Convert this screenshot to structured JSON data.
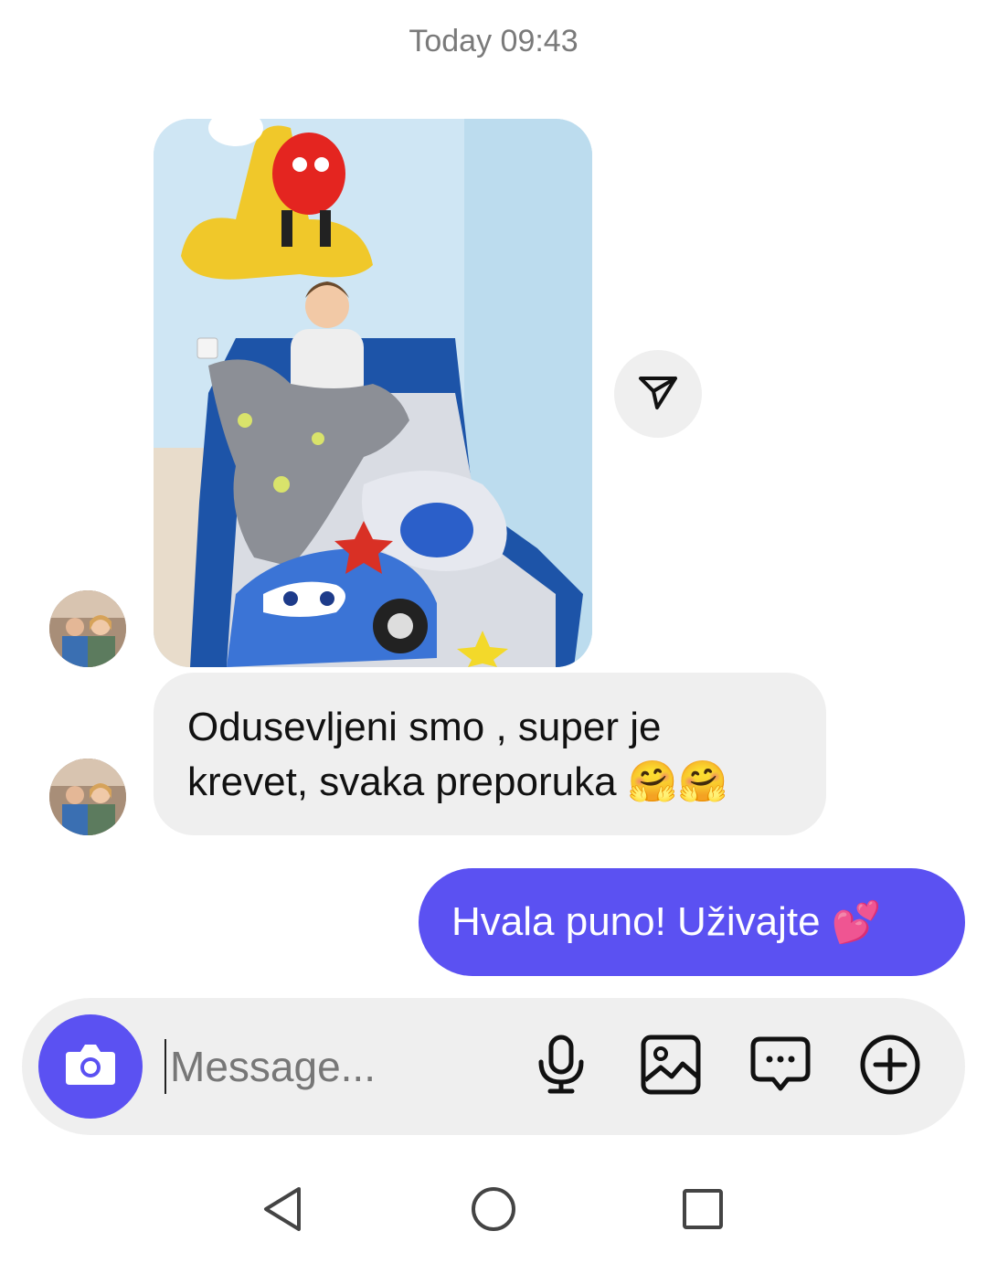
{
  "header": {
    "timestamp": "Today 09:43"
  },
  "conversation": {
    "incoming_text": {
      "line1": "Odusevljeni smo , super je",
      "line2": "krevet, svaka preporuka",
      "emojis": "🤗🤗"
    },
    "outgoing_text": {
      "text": "Hvala puno! Uživajte",
      "emoji": "💕"
    }
  },
  "composer": {
    "placeholder": "Message..."
  },
  "icons": {
    "share": "send-icon",
    "camera": "camera-icon",
    "mic": "microphone-icon",
    "gallery": "gallery-icon",
    "sticker": "chat-bubble-icon",
    "more": "plus-circle-icon",
    "nav": [
      "back-icon",
      "home-icon",
      "recents-icon"
    ]
  },
  "colors": {
    "accent": "#5b51f2",
    "incoming_bubble": "#efefef",
    "background": "#ffffff"
  }
}
